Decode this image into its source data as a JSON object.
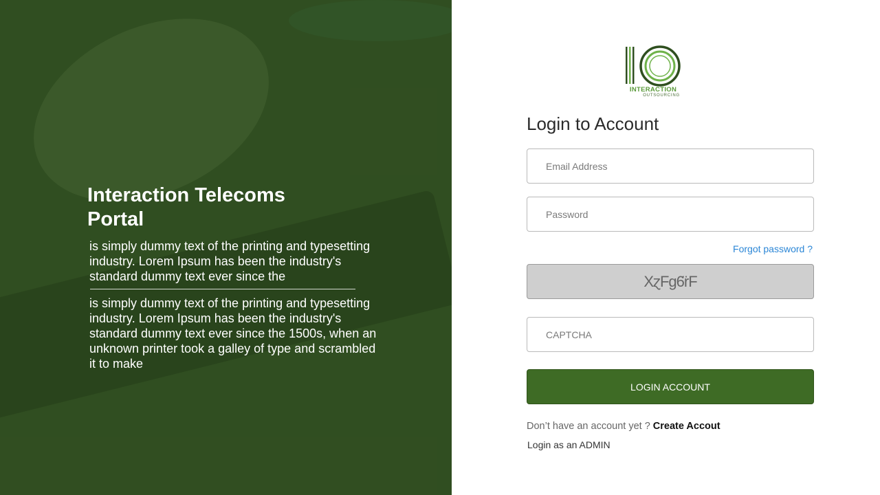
{
  "hero": {
    "title": "Interaction Telecoms Portal",
    "paragraph_1": "is simply dummy text of the printing and typesetting industry. Lorem Ipsum has been the industry's standard dummy text ever since the",
    "paragraph_2": "is simply dummy text of the printing and typesetting industry. Lorem Ipsum has been the industry's standard dummy text ever since the 1500s, when an unknown printer took a galley of type and scrambled it to make"
  },
  "logo": {
    "name": "INTERACTION",
    "subtitle": "OUTSOURCING",
    "colors": {
      "dark": "#2f4f1f",
      "light": "#6fb24a"
    }
  },
  "login": {
    "title": "Login to Account",
    "email_placeholder": "Email Address",
    "password_placeholder": "Password",
    "forgot_password": "Forgot password ?",
    "captcha_text": "XɀFg6̈rF",
    "captcha_placeholder": "CAPTCHA",
    "submit_label": "LOGIN ACCOUNT",
    "no_account_text": "Don’t have an account yet ?",
    "create_account_label": "Create Accout",
    "admin_login_label": "Login as an ADMIN"
  },
  "colors": {
    "brand_green": "#3e6b25",
    "link_blue": "#2b86d6"
  }
}
